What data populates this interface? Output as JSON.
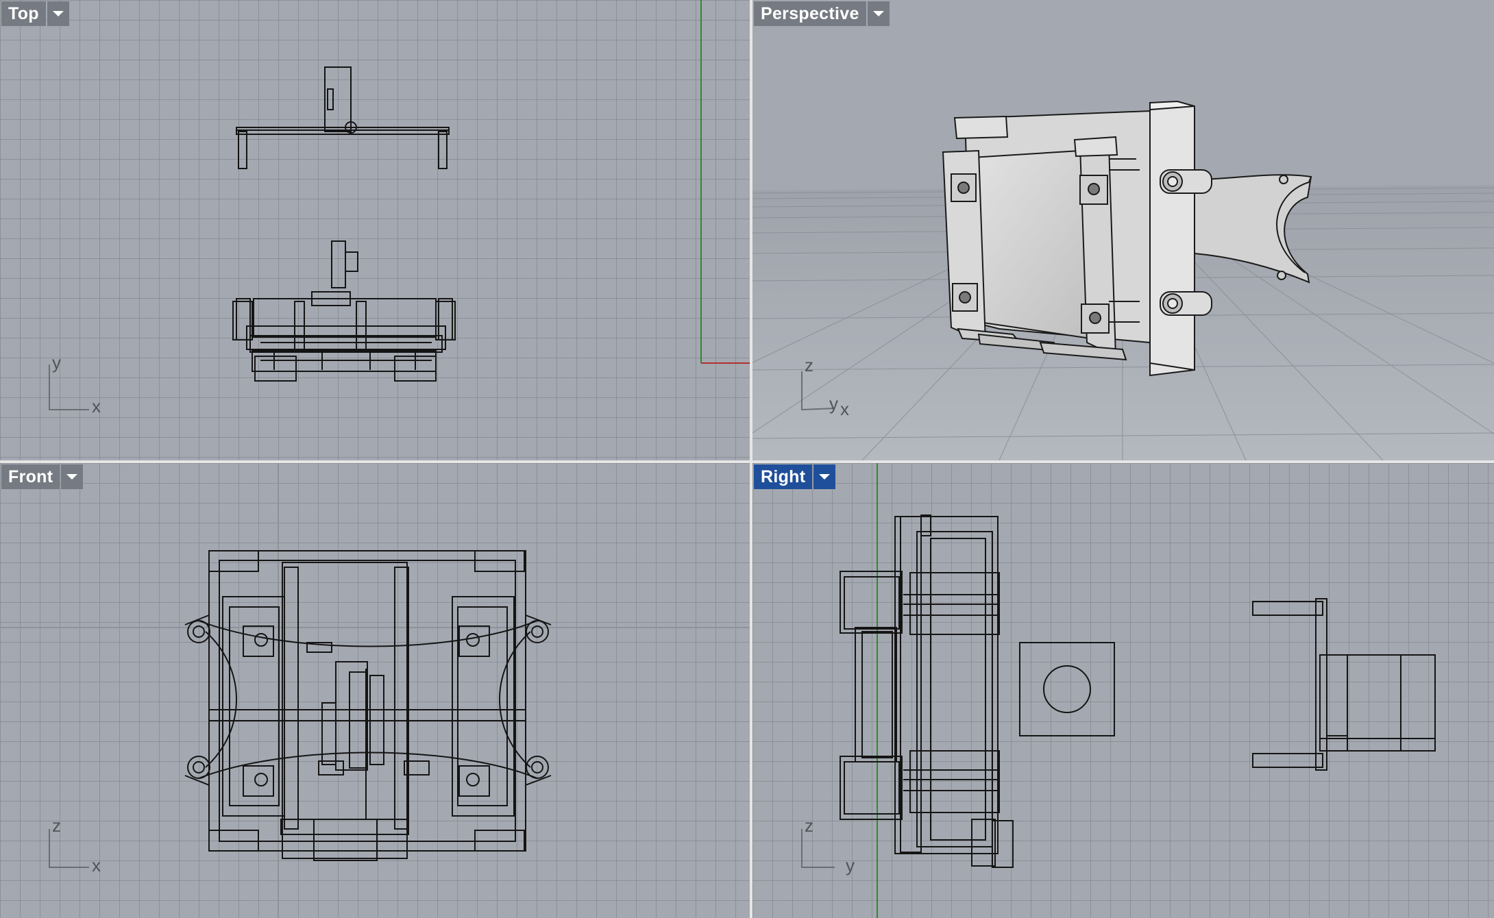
{
  "viewports": {
    "top": {
      "label": "Top",
      "axis_v": "y",
      "axis_h": "x",
      "active": false
    },
    "persp": {
      "label": "Perspective",
      "axis_v": "z",
      "axis_h": "y",
      "axis_h2": "x",
      "active": false
    },
    "front": {
      "label": "Front",
      "axis_v": "z",
      "axis_h": "x",
      "active": false
    },
    "right": {
      "label": "Right",
      "axis_v": "z",
      "axis_h": "y",
      "active": true
    }
  },
  "colors": {
    "viewport_bg": "#a4a8b0",
    "grid": "#787c84",
    "label_bg": "#767a82",
    "active_label_bg": "#1f4f9a",
    "x_axis": "#b03030",
    "y_axis": "#2f8a2f",
    "wire": "#141414"
  },
  "icons": {
    "viewport_menu": "chevron-down-icon"
  }
}
